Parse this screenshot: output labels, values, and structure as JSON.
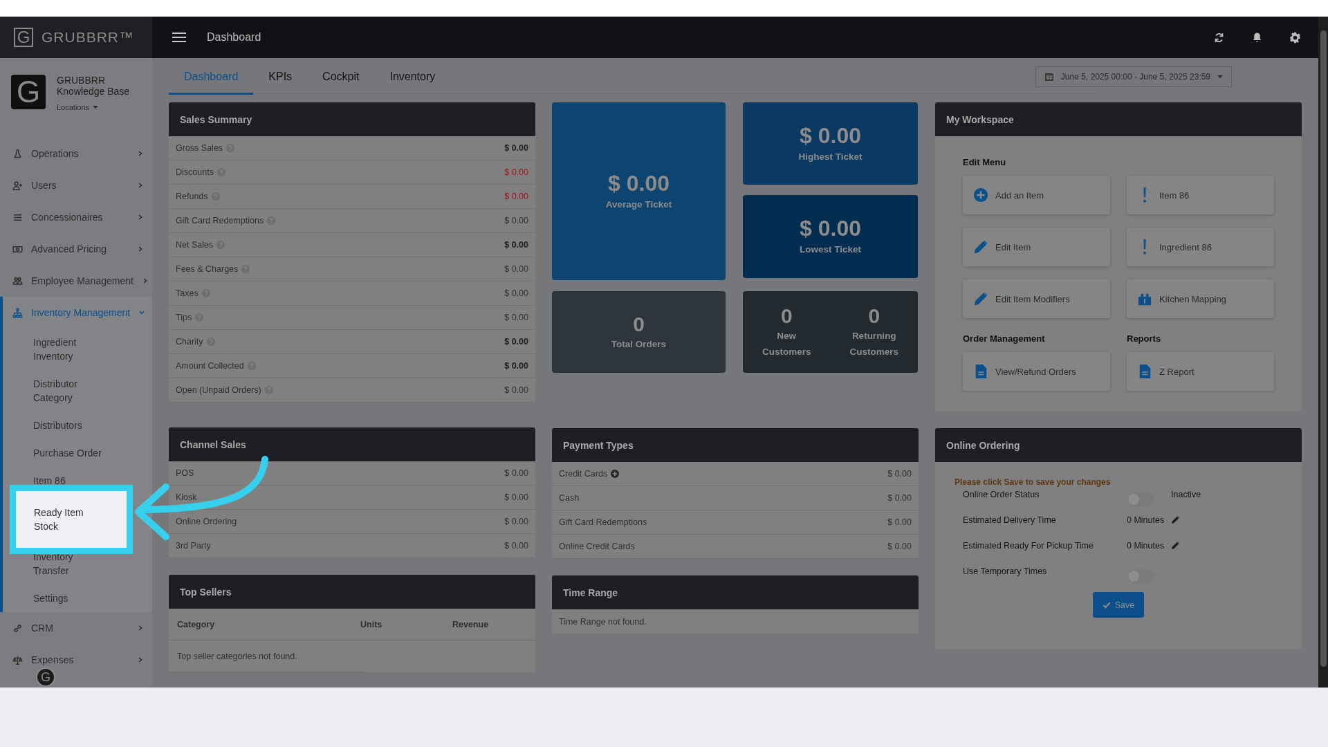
{
  "brand": {
    "mark": "G",
    "name": "GRUBBRR™"
  },
  "profile": {
    "avatar": "G",
    "name": "GRUBBRR\nKnowledge Base",
    "location": "Locations"
  },
  "sidebar": {
    "items": [
      {
        "label": "Operations",
        "expanded": false,
        "selected": false
      },
      {
        "label": "Users",
        "expanded": false,
        "selected": false
      },
      {
        "label": "Concessionaires",
        "expanded": false,
        "selected": false
      },
      {
        "label": "Advanced Pricing",
        "expanded": false,
        "selected": false
      },
      {
        "label": "Employee Management",
        "expanded": false,
        "selected": false
      },
      {
        "label": "Inventory Management",
        "expanded": true,
        "selected": true,
        "children": [
          {
            "label": "Ingredient\nInventory",
            "highlighted": false
          },
          {
            "label": "Distributor\nCategory",
            "highlighted": false
          },
          {
            "label": "Distributors",
            "highlighted": false
          },
          {
            "label": "Purchase Order",
            "highlighted": false
          },
          {
            "label": "Item 86",
            "highlighted": false
          },
          {
            "label": "Ready Item\nStock",
            "highlighted": true
          },
          {
            "label": "Inventory\nTransfer",
            "highlighted": false
          },
          {
            "label": "Settings",
            "highlighted": false
          }
        ]
      },
      {
        "label": "CRM",
        "expanded": false,
        "selected": false
      },
      {
        "label": "Expenses",
        "expanded": false,
        "selected": false
      }
    ],
    "help_avatar": "G"
  },
  "topbar": {
    "title": "Dashboard"
  },
  "tabs": [
    {
      "label": "Dashboard",
      "selected": true
    },
    {
      "label": "KPIs",
      "selected": false
    },
    {
      "label": "Cockpit",
      "selected": false
    },
    {
      "label": "Inventory",
      "selected": false
    }
  ],
  "date_range": "June 5, 2025 00:00 - June 5, 2025 23:59",
  "sales_summary": {
    "title": "Sales Summary",
    "rows": [
      {
        "label": "Gross Sales",
        "value": "$ 0.00",
        "kind": "bold"
      },
      {
        "label": "Discounts",
        "value": "$ 0.00",
        "kind": "negative"
      },
      {
        "label": "Refunds",
        "value": "$ 0.00",
        "kind": "negative"
      },
      {
        "label": "Gift Card Redemptions",
        "value": "$ 0.00",
        "kind": "normal"
      },
      {
        "label": "Net Sales",
        "value": "$ 0.00",
        "kind": "bold"
      },
      {
        "label": "Fees & Charges",
        "value": "$ 0.00",
        "kind": "normal"
      },
      {
        "label": "Taxes",
        "value": "$ 0.00",
        "kind": "normal"
      },
      {
        "label": "Tips",
        "value": "$ 0.00",
        "kind": "normal"
      },
      {
        "label": "Charity",
        "value": "$ 0.00",
        "kind": "bold"
      },
      {
        "label": "Amount Collected",
        "value": "$ 0.00",
        "kind": "bold"
      },
      {
        "label": "Open (Unpaid Orders)",
        "value": "$ 0.00",
        "kind": "normal"
      }
    ]
  },
  "tiles": {
    "average": {
      "value": "$ 0.00",
      "label": "Average Ticket"
    },
    "highest": {
      "value": "$ 0.00",
      "label": "Highest Ticket"
    },
    "lowest": {
      "value": "$ 0.00",
      "label": "Lowest Ticket"
    },
    "total_orders": {
      "value": "0",
      "label": "Total Orders"
    },
    "customers": [
      {
        "value": "0",
        "label": "New\nCustomers"
      },
      {
        "value": "0",
        "label": "Returning\nCustomers"
      }
    ]
  },
  "workspace": {
    "title": "My Workspace",
    "sections": [
      {
        "title": "Edit Menu",
        "buttons": [
          {
            "label": "Add an Item",
            "kind": "plus"
          },
          {
            "label": "Item 86",
            "kind": "alert"
          },
          {
            "label": "Edit Item",
            "kind": "pencil"
          },
          {
            "label": "Ingredient 86",
            "kind": "alert"
          },
          {
            "label": "Edit Item Modifiers",
            "kind": "pencil"
          },
          {
            "label": "Kitchen Mapping",
            "kind": "map"
          }
        ]
      },
      {
        "title": "Order Management",
        "buttons": [
          {
            "label": "View/Refund Orders",
            "kind": "document"
          }
        ]
      },
      {
        "title": "Reports",
        "buttons": [
          {
            "label": "Z Report",
            "kind": "document"
          }
        ]
      }
    ]
  },
  "channel_sales": {
    "title": "Channel Sales",
    "rows": [
      {
        "label": "POS",
        "value": "$ 0.00"
      },
      {
        "label": "Kiosk",
        "value": "$ 0.00"
      },
      {
        "label": "Online Ordering",
        "value": "$ 0.00"
      },
      {
        "label": "3rd Party",
        "value": "$ 0.00"
      }
    ]
  },
  "payment_types": {
    "title": "Payment Types",
    "rows": [
      {
        "label": "Credit Cards",
        "value": "$ 0.00",
        "expandable": true
      },
      {
        "label": "Cash",
        "value": "$ 0.00",
        "expandable": false
      },
      {
        "label": "Gift Card Redemptions",
        "value": "$ 0.00",
        "expandable": false
      },
      {
        "label": "Online Credit Cards",
        "value": "$ 0.00",
        "expandable": false
      }
    ]
  },
  "online_ordering": {
    "title": "Online Ordering",
    "notice": "Please click Save to save your changes",
    "rows": [
      {
        "label": "Online Order Status",
        "kind": "toggle",
        "on": false,
        "status": "Inactive"
      },
      {
        "label": "Estimated Delivery Time",
        "kind": "value",
        "value": "0 Minutes"
      },
      {
        "label": "Estimated Ready For Pickup Time",
        "kind": "value",
        "value": "0 Minutes"
      },
      {
        "label": "Use Temporary Times",
        "kind": "toggle",
        "on": false
      }
    ],
    "save": "Save"
  },
  "top_sellers": {
    "title": "Top Sellers",
    "columns": [
      "Category",
      "Units",
      "Revenue"
    ],
    "empty": "Top seller categories not found."
  },
  "time_range": {
    "title": "Time Range",
    "empty": "Time Range not found."
  }
}
